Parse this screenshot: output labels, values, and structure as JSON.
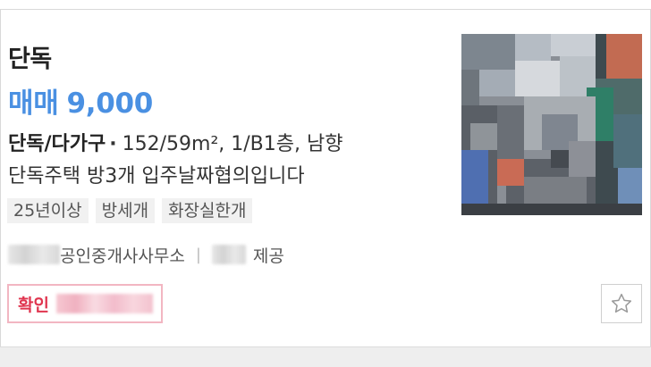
{
  "listing": {
    "type_title": "단독",
    "price": {
      "trade_type": "매매",
      "amount": "9,000"
    },
    "spec": {
      "category": "단독/다가구",
      "separator": "·",
      "details": "152/59m², 1/B1층, 남향"
    },
    "description": "단독주택 방3개 입주날짜협의입니다",
    "tags": [
      "25년이상",
      "방세개",
      "화장실한개"
    ],
    "agency": {
      "office_suffix": "공인중개사사무소",
      "divider": "|",
      "provider_suffix": "제공"
    },
    "confirm": {
      "label": "확인"
    },
    "favorite": {
      "icon": "star-outline-icon"
    },
    "thumbnail": {
      "description": "pixelated street photo of house with blue door and sky"
    }
  },
  "colors": {
    "price_blue": "#4a90e2",
    "confirm_red": "#e0354f",
    "confirm_border": "#f2b6c2",
    "tag_bg": "#f1f1f1"
  }
}
